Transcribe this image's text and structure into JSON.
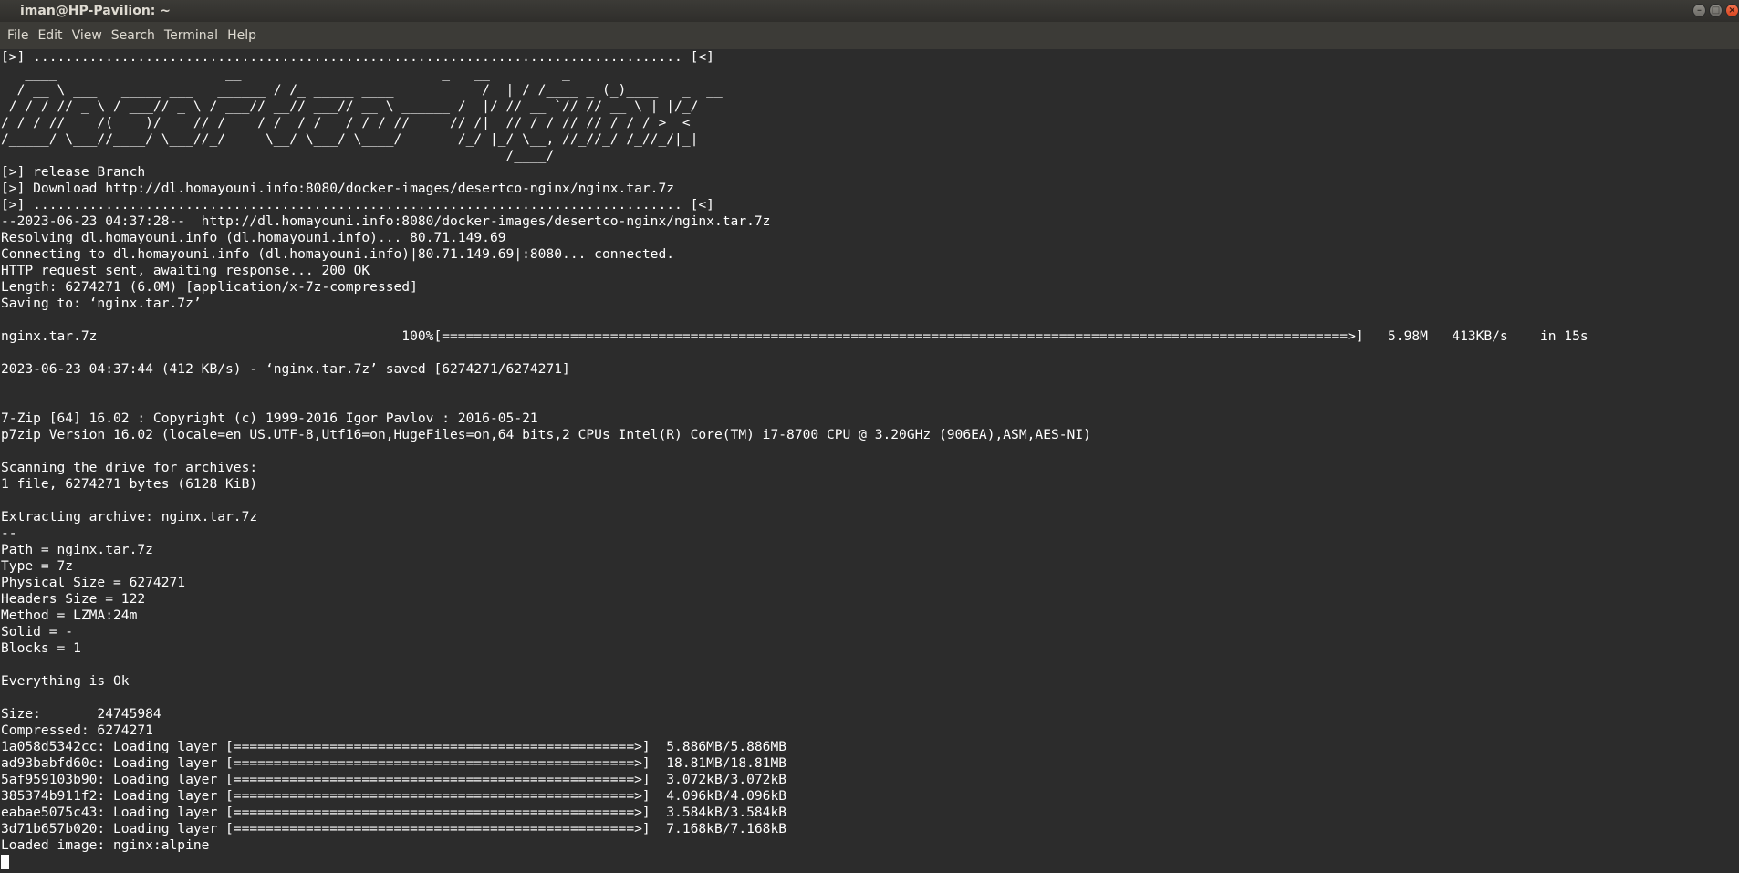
{
  "window": {
    "title": "iman@HP-Pavilion: ~",
    "buttons": {
      "minimize": "–",
      "maximize": "□",
      "close": "×"
    }
  },
  "menu": [
    "File",
    "Edit",
    "View",
    "Search",
    "Terminal",
    "Help"
  ],
  "terminal": {
    "lines": [
      "[>] ................................................................................. [<]",
      "   ____                     __                         _   __         _             ",
      "  / __ \\ ___   _____ ___   ______ / /_ _____ ____           /  | / /____ _ (_)____   _  __",
      " / / / // _ \\ / ___// _ \\ / ___// __// ___// __ \\ ______ /  |/ // __ `// // __ \\ | |/_/",
      "/ /_/ //  __/(__  )/  __// /    / /_ / /__ / /_/ //_____// /|  // /_/ // // / / /_>  <",
      "/_____/ \\___//____/ \\___//_/     \\__/ \\___/ \\____/       /_/ |_/ \\__, //_//_/ /_//_/|_|",
      "                                                               /____/",
      "[>] release Branch",
      "[>] Download http://dl.homayouni.info:8080/docker-images/desertco-nginx/nginx.tar.7z",
      "[>] ................................................................................. [<]",
      "--2023-06-23 04:37:28--  http://dl.homayouni.info:8080/docker-images/desertco-nginx/nginx.tar.7z",
      "Resolving dl.homayouni.info (dl.homayouni.info)... 80.71.149.69",
      "Connecting to dl.homayouni.info (dl.homayouni.info)|80.71.149.69|:8080... connected.",
      "HTTP request sent, awaiting response... 200 OK",
      "Length: 6274271 (6.0M) [application/x-7z-compressed]",
      "Saving to: ‘nginx.tar.7z’",
      "",
      "nginx.tar.7z                                      100%[=================================================================================================================>]   5.98M   413KB/s    in 15s",
      "",
      "2023-06-23 04:37:44 (412 KB/s) - ‘nginx.tar.7z’ saved [6274271/6274271]",
      "",
      "",
      "7-Zip [64] 16.02 : Copyright (c) 1999-2016 Igor Pavlov : 2016-05-21",
      "p7zip Version 16.02 (locale=en_US.UTF-8,Utf16=on,HugeFiles=on,64 bits,2 CPUs Intel(R) Core(TM) i7-8700 CPU @ 3.20GHz (906EA),ASM,AES-NI)",
      "",
      "Scanning the drive for archives:",
      "1 file, 6274271 bytes (6128 KiB)",
      "",
      "Extracting archive: nginx.tar.7z",
      "--",
      "Path = nginx.tar.7z",
      "Type = 7z",
      "Physical Size = 6274271",
      "Headers Size = 122",
      "Method = LZMA:24m",
      "Solid = -",
      "Blocks = 1",
      "",
      "Everything is Ok",
      "",
      "Size:       24745984",
      "Compressed: 6274271",
      "1a058d5342cc: Loading layer [==================================================>]  5.886MB/5.886MB",
      "ad93babfd60c: Loading layer [==================================================>]  18.81MB/18.81MB",
      "5af959103b90: Loading layer [==================================================>]  3.072kB/3.072kB",
      "385374b911f2: Loading layer [==================================================>]  4.096kB/4.096kB",
      "eabae5075c43: Loading layer [==================================================>]  3.584kB/3.584kB",
      "3d71b657b020: Loading layer [==================================================>]  7.168kB/7.168kB",
      "Loaded image: nginx:alpine"
    ]
  }
}
